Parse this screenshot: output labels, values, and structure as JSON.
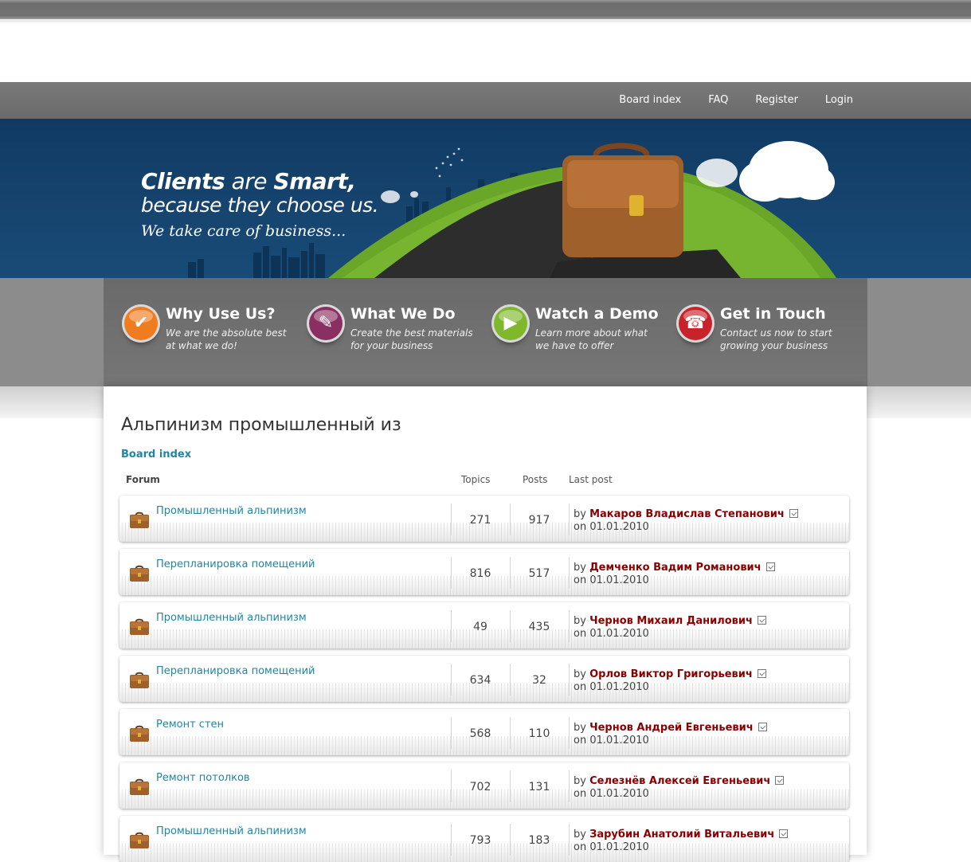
{
  "nav": {
    "items": [
      "Board index",
      "FAQ",
      "Register",
      "Login"
    ]
  },
  "banner": {
    "line1_a": "Clients",
    "line1_b": " are ",
    "line1_c": "Smart,",
    "line2": "because they choose us.",
    "line3": "We take care of business..."
  },
  "features": [
    {
      "title": "Why Use Us?",
      "desc1": "We are the absolute best",
      "desc2": "at what we do!",
      "icon": "check-icon",
      "color": "#f07c20"
    },
    {
      "title": "What We Do",
      "desc1": "Create the best materials",
      "desc2": "for your business",
      "icon": "pencil-icon",
      "color": "#8a2f62"
    },
    {
      "title": "Watch a Demo",
      "desc1": "Learn more about what",
      "desc2": "we have to offer",
      "icon": "play-icon",
      "color": "#7fb82a"
    },
    {
      "title": "Get in Touch",
      "desc1": "Contact us now to start",
      "desc2": "growing your business",
      "icon": "phone-icon",
      "color": "#c8232a"
    }
  ],
  "page": {
    "title": "Альпинизм промышленный из",
    "breadcrumb": "Board index"
  },
  "table": {
    "headers": {
      "forum": "Forum",
      "topics": "Topics",
      "posts": "Posts",
      "last_post": "Last post"
    },
    "by": "by",
    "on": "on",
    "rows": [
      {
        "forum": "Промышленный альпинизм",
        "topics": "271",
        "posts": "917",
        "author": "Макаров Владислав Степанович",
        "date": "01.01.2010"
      },
      {
        "forum": "Перепланировка помещений",
        "topics": "816",
        "posts": "517",
        "author": "Демченко Вадим Романович",
        "date": "01.01.2010"
      },
      {
        "forum": "Промышленный альпинизм",
        "topics": "49",
        "posts": "435",
        "author": "Чернов Михаил Данилович",
        "date": "01.01.2010"
      },
      {
        "forum": "Перепланировка помещений",
        "topics": "634",
        "posts": "32",
        "author": "Орлов Виктор Григорьевич",
        "date": "01.01.2010"
      },
      {
        "forum": "Ремонт стен",
        "topics": "568",
        "posts": "110",
        "author": "Чернов Андрей Евгеньевич",
        "date": "01.01.2010"
      },
      {
        "forum": "Ремонт потолков",
        "topics": "702",
        "posts": "131",
        "author": "Селезнёв Алексей Евгеньевич",
        "date": "01.01.2010"
      },
      {
        "forum": "Промышленный альпинизм",
        "topics": "793",
        "posts": "183",
        "author": "Зарубин Анатолий Витальевич",
        "date": "01.01.2010"
      }
    ]
  }
}
